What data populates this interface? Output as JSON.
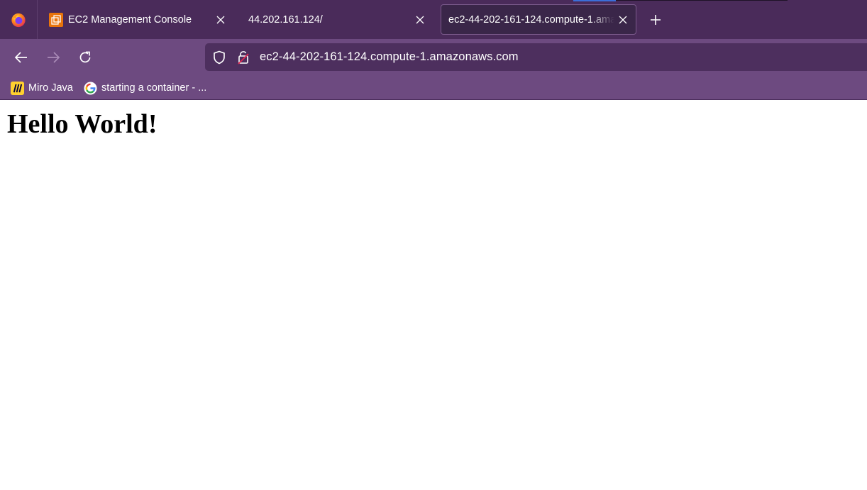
{
  "tabs": [
    {
      "title": "EC2 Management Console",
      "icon": "aws-ec2-icon",
      "active": false
    },
    {
      "title": "44.202.161.124/",
      "icon": "",
      "active": false
    },
    {
      "title": "ec2-44-202-161-124.compute-1.amazonaws.com",
      "icon": "",
      "active": true
    }
  ],
  "address_bar": {
    "url": "ec2-44-202-161-124.compute-1.amazonaws.com"
  },
  "bookmarks": [
    {
      "label": "Miro Java",
      "icon": "miro-icon"
    },
    {
      "label": "starting a container - ...",
      "icon": "google-icon"
    }
  ],
  "page": {
    "heading": "Hello World!"
  },
  "colors": {
    "tabstrip": "#4a2b5a",
    "toolbar": "#6d4a80",
    "urlbar": "#4d2f5e",
    "active_tab": "#3a2649",
    "ec2_orange": "#e8740c",
    "miro_yellow": "#ffd02f"
  }
}
